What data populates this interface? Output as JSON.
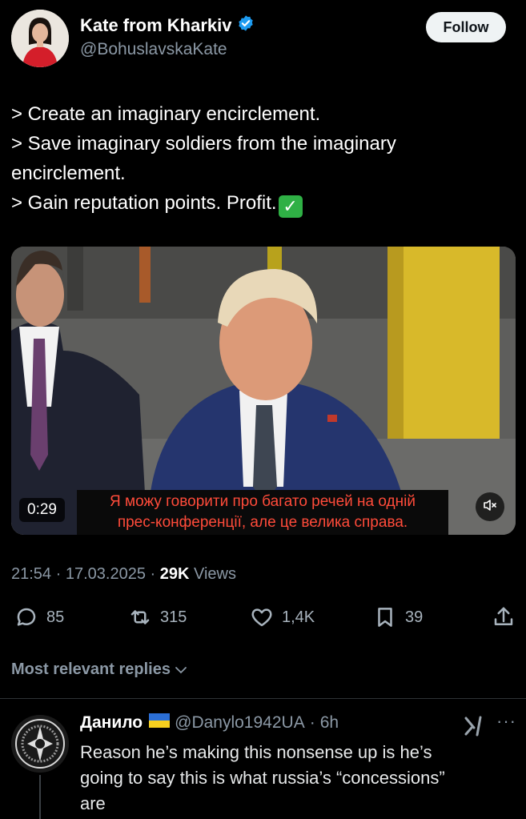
{
  "author": {
    "name": "Kate from Kharkiv",
    "handle": "@BohuslavskaKate",
    "verified": true,
    "verified_color": "#1d9bf0"
  },
  "follow_button": {
    "label": "Follow"
  },
  "tweet": {
    "lines": [
      "> Create an imaginary encirclement.",
      "> Save imaginary soldiers from the imaginary",
      "encirclement.",
      "> Gain reputation points. Profit."
    ],
    "emoji": "white-heavy-check-mark"
  },
  "video": {
    "duration": "0:29",
    "subtitle_line1": "Я можу говорити про багато речей на одній",
    "subtitle_line2": "прес-конференції, але це велика справа.",
    "subtitle_color": "#ff4b3a",
    "mute_icon": "speaker-muted-icon"
  },
  "meta": {
    "time": "21:54",
    "date": "17.03.2025",
    "views_count": "29K",
    "views_label": "Views"
  },
  "actions": {
    "replies": "85",
    "reposts": "315",
    "likes": "1,4K",
    "bookmarks": "39"
  },
  "replies_header": {
    "label": "Most relevant replies"
  },
  "reply": {
    "name": "Данило",
    "flag": "ukraine-flag",
    "handle": "@Danylo1942UA",
    "age": "6h",
    "text_lines": [
      "Reason he’s making this nonsense up is he’s",
      "going to say this is what russia’s “concessions”",
      "are"
    ]
  },
  "colors": {
    "background": "#000000",
    "muted_text": "#8b98a5",
    "divider": "#2f3336"
  }
}
